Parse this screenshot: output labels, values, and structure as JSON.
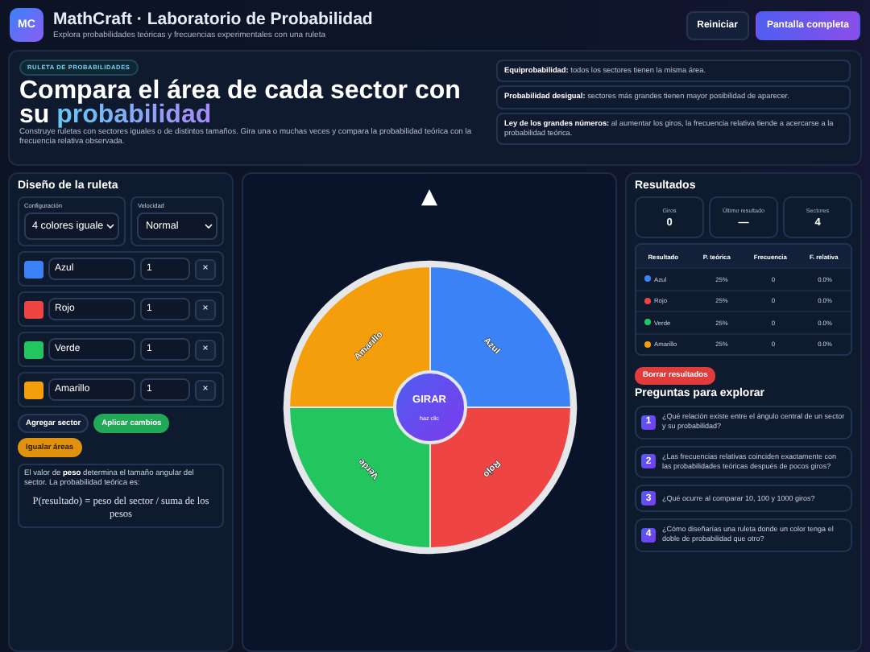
{
  "header": {
    "logo": "MC",
    "title": "MathCraft · Laboratorio de Probabilidad",
    "subtitle": "Explora probabilidades teóricas y frecuencias experimentales con una ruleta",
    "buttons": [
      {
        "label": "Reiniciar",
        "kind": "secondary"
      },
      {
        "label": "Pantalla completa",
        "kind": "primary"
      }
    ]
  },
  "hero": {
    "badge": "RULETA DE PROBABILIDADES",
    "title": "Compara el área de cada sector con su ",
    "title_highlight": "probabilidad",
    "description": "Construye ruletas con sectores iguales o de distintos tamaños. Gira una o muchas veces y compara la probabilidad teórica con la frecuencia relativa observada.",
    "notes": [
      "**Equiprobabilidad:** todos los sectores tienen la misma área.",
      "**Probabilidad desigual:** sectores más grandes tienen mayor posibilidad de aparecer.",
      "**Ley de los grandes números:** al aumentar los giros, la frecuencia relativa tiende a acercarse a la probabilidad teórica."
    ]
  },
  "design": {
    "title": "Diseño de la ruleta",
    "config": {
      "label": "Configuración",
      "value": "4 colores iguale"
    },
    "speed": {
      "label": "Velocidad",
      "value": "Normal"
    },
    "sectors": [
      {
        "name": "Azul",
        "weight": "1",
        "color": "#3b82f6",
        "remove": "×"
      },
      {
        "name": "Rojo",
        "weight": "1",
        "color": "#ef4444",
        "remove": "×"
      },
      {
        "name": "Verde",
        "weight": "1",
        "color": "#22c55e",
        "remove": "×"
      },
      {
        "name": "Amarillo",
        "weight": "1",
        "color": "#f59e0b",
        "remove": "×"
      }
    ],
    "buttons": [
      {
        "label": "Agregar sector",
        "kind": "dark"
      },
      {
        "label": "Aplicar cambios",
        "kind": "green"
      },
      {
        "label": "Igualar áreas",
        "kind": "orange"
      }
    ],
    "info": "El valor de **peso** determina el tamaño angular del sector. La probabilidad teórica es:",
    "formula": "P(resultado) = peso del sector / suma de los pesos"
  },
  "wheel": {
    "pointer": "▲",
    "sectors": [
      {
        "label": "Azul",
        "color": "#3b82f6"
      },
      {
        "label": "Rojo",
        "color": "#ef4444"
      },
      {
        "label": "Verde",
        "color": "#22c55e"
      },
      {
        "label": "Amarillo",
        "color": "#f59e0b"
      }
    ],
    "center_label": "GIRAR",
    "center_hint": "haz clic"
  },
  "results": {
    "title": "Resultados",
    "stats": [
      {
        "label": "Giros",
        "value": "0"
      },
      {
        "label": "Último resultado",
        "value": "—"
      },
      {
        "label": "Sectores",
        "value": "4"
      }
    ],
    "columns": [
      "Resultado",
      "P. teórica",
      "Frecuencia",
      "F. relativa"
    ],
    "rows": [
      {
        "result": "Azul",
        "color": "#3b82f6",
        "theoretical": "25%",
        "frequency": "0",
        "relative": "0.0%"
      },
      {
        "result": "Rojo",
        "color": "#ef4444",
        "theoretical": "25%",
        "frequency": "0",
        "relative": "0.0%"
      },
      {
        "result": "Verde",
        "color": "#22c55e",
        "theoretical": "25%",
        "frequency": "0",
        "relative": "0.0%"
      },
      {
        "result": "Amarillo",
        "color": "#f59e0b",
        "theoretical": "25%",
        "frequency": "0",
        "relative": "0.0%"
      }
    ],
    "clear_button": "Borrar resultados"
  },
  "questions": {
    "title": "Preguntas para explorar",
    "items": [
      {
        "number": "1",
        "text": "¿Qué relación existe entre el ángulo central de un sector y su probabilidad?"
      },
      {
        "number": "2",
        "text": "¿Las frecuencias relativas coinciden exactamente con las probabilidades teóricas después de pocos giros?"
      },
      {
        "number": "3",
        "text": "¿Qué ocurre al comparar 10, 100 y 1000 giros?"
      },
      {
        "number": "4",
        "text": "¿Cómo diseñarías una ruleta donde un color tenga el doble de probabilidad que otro?"
      }
    ]
  }
}
